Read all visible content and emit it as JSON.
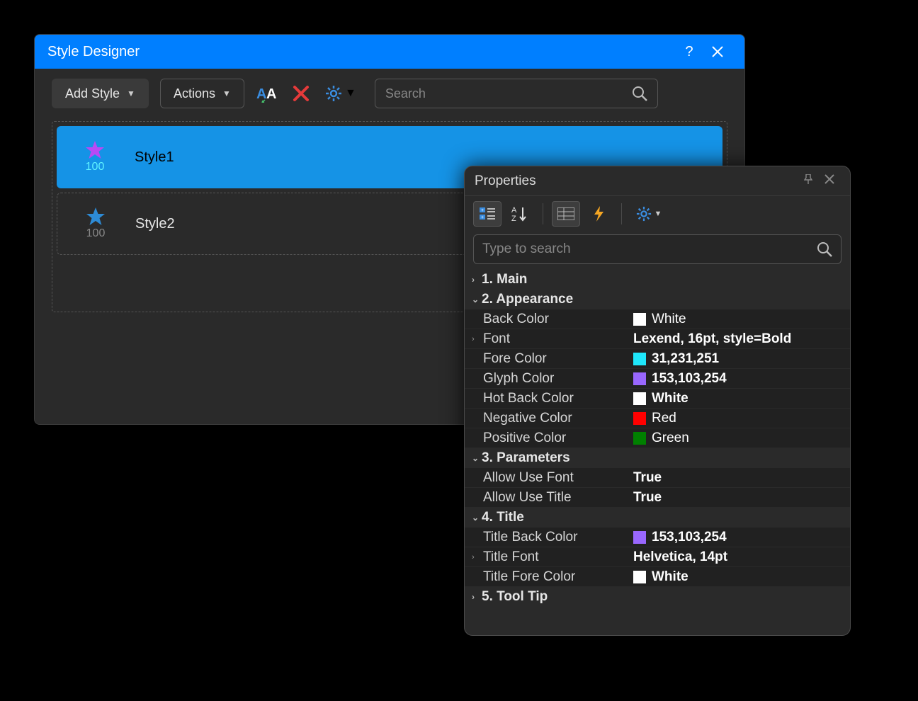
{
  "window": {
    "title": "Style Designer"
  },
  "toolbar": {
    "add_style_label": "Add Style",
    "actions_label": "Actions",
    "search_placeholder": "Search"
  },
  "styles_list": [
    {
      "name": "Style1",
      "count": "100",
      "star_color": "#b84af5",
      "selected": true
    },
    {
      "name": "Style2",
      "count": "100",
      "star_color": "#2d8bd6",
      "selected": false
    }
  ],
  "properties_panel": {
    "title": "Properties",
    "search_placeholder": "Type to search",
    "categories": [
      {
        "header": "1. Main",
        "expanded": false,
        "rows": []
      },
      {
        "header": "2. Appearance",
        "expanded": true,
        "rows": [
          {
            "name": "Back Color",
            "value": "White",
            "swatch": "#ffffff",
            "bold": false
          },
          {
            "name": "Font",
            "value": "Lexend, 16pt, style=Bold",
            "bold": true,
            "expandable": true
          },
          {
            "name": "Fore Color",
            "value": "31,231,251",
            "swatch": "#1fe7fb",
            "bold": true
          },
          {
            "name": "Glyph Color",
            "value": "153,103,254",
            "swatch": "#9967fe",
            "bold": true
          },
          {
            "name": "Hot Back Color",
            "value": "White",
            "swatch": "#ffffff",
            "bold": true
          },
          {
            "name": "Negative Color",
            "value": "Red",
            "swatch": "#ff0000",
            "bold": false
          },
          {
            "name": "Positive Color",
            "value": "Green",
            "swatch": "#008000",
            "bold": false
          }
        ]
      },
      {
        "header": "3. Parameters",
        "expanded": true,
        "rows": [
          {
            "name": "Allow Use Font",
            "value": "True",
            "bold": true
          },
          {
            "name": "Allow Use Title",
            "value": "True",
            "bold": true
          }
        ]
      },
      {
        "header": "4. Title",
        "expanded": true,
        "rows": [
          {
            "name": "Title Back Color",
            "value": "153,103,254",
            "swatch": "#9967fe",
            "bold": true
          },
          {
            "name": "Title Font",
            "value": "Helvetica, 14pt",
            "bold": true,
            "expandable": true
          },
          {
            "name": "Title Fore Color",
            "value": "White",
            "swatch": "#ffffff",
            "bold": true
          }
        ]
      },
      {
        "header": "5. Tool Tip",
        "expanded": false,
        "rows": []
      }
    ]
  }
}
